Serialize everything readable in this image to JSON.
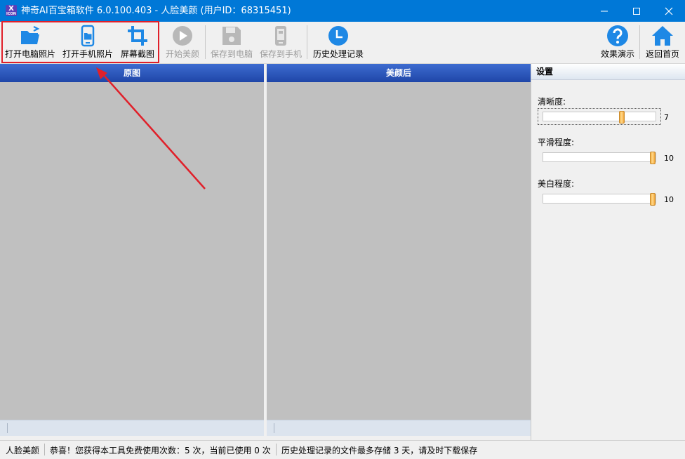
{
  "window": {
    "app_icon_text": "X",
    "app_icon_subtext": "ICON",
    "title": "神奇AI百宝箱软件 6.0.100.403 - 人脸美颜 (用户ID：68315451)",
    "controls": [
      "minimize-icon",
      "maximize-icon",
      "close-icon"
    ]
  },
  "toolbar": {
    "open_pc_photo": "打开电脑照片",
    "open_phone_photo": "打开手机照片",
    "screenshot": "屏幕截图",
    "start_beauty": "开始美颜",
    "save_to_pc": "保存到电脑",
    "save_to_phone": "保存到手机",
    "history": "历史处理记录",
    "effect_demo": "效果演示",
    "back_home": "返回首页"
  },
  "panels": {
    "original_title": "原图",
    "result_title": "美颜后"
  },
  "settings": {
    "title": "设置",
    "clarity": {
      "label": "清晰度:",
      "value": "7",
      "level": 0.7
    },
    "smoothness": {
      "label": "平滑程度:",
      "value": "10",
      "level": 1.0
    },
    "whitening": {
      "label": "美白程度:",
      "value": "10",
      "level": 1.0
    }
  },
  "status": {
    "module": "人脸美颜",
    "usage": "恭喜！您获得本工具免费使用次数：5 次，当前已使用 0 次",
    "history_note": "历史处理记录的文件最多存储 3 天，请及时下载保存"
  },
  "colors": {
    "titlebar": "#0078d7",
    "primary_icon": "#1e88e5",
    "highlight": "#e0202a",
    "disabled_icon": "#b8b8b8"
  }
}
